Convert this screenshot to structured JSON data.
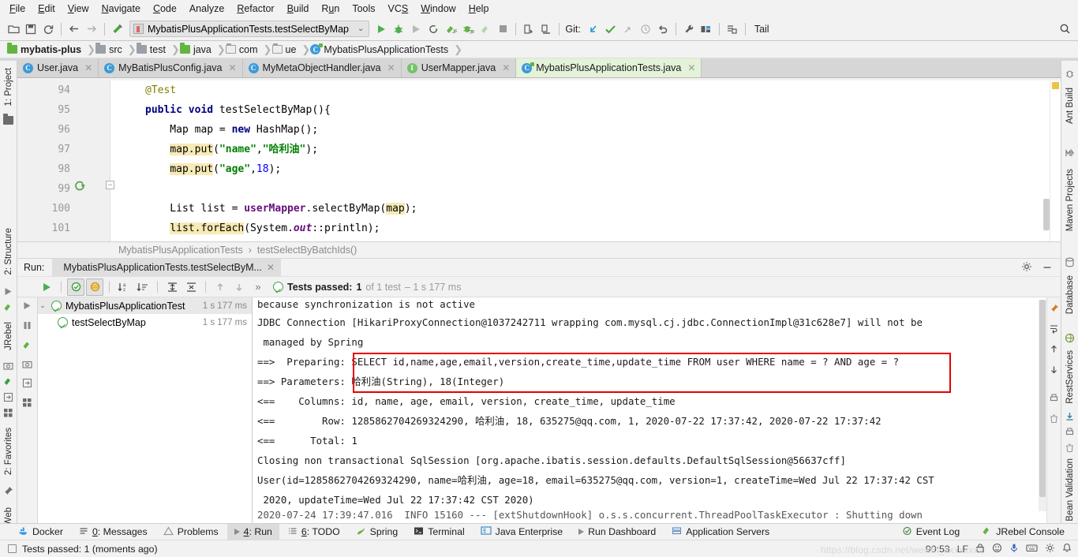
{
  "menu": {
    "items": [
      "File",
      "Edit",
      "View",
      "Navigate",
      "Code",
      "Analyze",
      "Refactor",
      "Build",
      "Run",
      "Tools",
      "VCS",
      "Window",
      "Help"
    ]
  },
  "toolbar": {
    "run_config": "MybatisPlusApplicationTests.testSelectByMap",
    "git_label": "Git:",
    "tail_label": "Tail",
    "icons": [
      "open-folder-icon",
      "save-icon",
      "sync-icon",
      "back-arrow-icon",
      "forward-arrow-icon",
      "build-hammer-icon",
      "run-icon",
      "debug-icon",
      "run-with-coverage-icon",
      "profiler-icon",
      "run-junit-icon",
      "debug-junit-icon",
      "stop-icon",
      "update-project-icon",
      "commit-icon",
      "vcs-pull-icon",
      "vcs-push-icon",
      "vcs-cherrypick-icon",
      "vcs-history-icon",
      "vcs-revert-icon",
      "settings-wrench-icon",
      "project-structure-icon",
      "database-icon",
      "search-icon"
    ]
  },
  "breadcrumb": {
    "items": [
      {
        "label": "mybatis-plus",
        "icon": "module-icon",
        "bold": true
      },
      {
        "label": "src",
        "icon": "folder-icon",
        "bold": false
      },
      {
        "label": "test",
        "icon": "folder-icon",
        "bold": false
      },
      {
        "label": "java",
        "icon": "source-folder-icon",
        "bold": false
      },
      {
        "label": "com",
        "icon": "package-icon",
        "bold": false
      },
      {
        "label": "ue",
        "icon": "package-icon",
        "bold": false
      },
      {
        "label": "MybatisPlusApplicationTests",
        "icon": "test-class-icon",
        "bold": false
      }
    ]
  },
  "tabs": [
    {
      "label": "User.java",
      "icon": "class-icon",
      "active": false
    },
    {
      "label": "MyBatisPlusConfig.java",
      "icon": "class-icon",
      "active": false
    },
    {
      "label": "MyMetaObjectHandler.java",
      "icon": "class-icon",
      "active": false
    },
    {
      "label": "UserMapper.java",
      "icon": "interface-icon",
      "active": false
    },
    {
      "label": "MybatisPlusApplicationTests.java",
      "icon": "test-class-icon",
      "active": true
    }
  ],
  "left_strip": {
    "project_label": "1: Project",
    "structure_label": "2: Structure",
    "jrebel_label": "JRebel",
    "favorites_label": "2: Favorites",
    "web_label": "Web"
  },
  "right_strip": {
    "ant_label": "Ant Build",
    "maven_label": "Maven Projects",
    "database_label": "Database",
    "rest_label": "RestServices",
    "bean_label": "Bean Validation"
  },
  "editor": {
    "lines": [
      {
        "num": "94",
        "code": "    @Test"
      },
      {
        "num": "95",
        "code": "    public void testSelectByMap(){"
      },
      {
        "num": "96",
        "code": "        Map map = new HashMap();"
      },
      {
        "num": "97",
        "code": "        map.put(\"name\",\"哈利油\");"
      },
      {
        "num": "98",
        "code": "        map.put(\"age\",18);"
      },
      {
        "num": "99",
        "code": ""
      },
      {
        "num": "100",
        "code": "        List list = userMapper.selectByMap(map);"
      },
      {
        "num": "101",
        "code": "        list.forEach(System.out::println);"
      }
    ]
  },
  "editor_breadcrumb": {
    "class_name": "MybatisPlusApplicationTests",
    "separator": "›",
    "method_name": "testSelectByBatchIds()"
  },
  "run_window": {
    "title": "Run:",
    "tab_label": "MybatisPlusApplicationTests.testSelectByM...",
    "toolbar_icons": [
      "rerun-icon",
      "toggle-passed-icon",
      "toggle-ignored-icon",
      "sort-alphabetically-icon",
      "sort-duration-icon",
      "expand-all-icon",
      "collapse-all-icon",
      "prev-failed-icon",
      "next-failed-icon",
      "more-icon"
    ],
    "status": {
      "prefix": "Tests passed:",
      "count": "1",
      "of": "of 1 test",
      "duration": "– 1 s 177 ms"
    },
    "tree": [
      {
        "label": "MybatisPlusApplicationTest",
        "time": "1 s 177 ms",
        "level": 0,
        "selected": true
      },
      {
        "label": "testSelectByMap",
        "time": "1 s 177 ms",
        "level": 1,
        "selected": false
      }
    ]
  },
  "console": {
    "lines": [
      "because synchronization is not active",
      "JDBC Connection [HikariProxyConnection@1037242711 wrapping com.mysql.cj.jdbc.ConnectionImpl@31c628e7] will not be",
      " managed by Spring",
      "==>  Preparing: SELECT id,name,age,email,version,create_time,update_time FROM user WHERE name = ? AND age = ?",
      "==> Parameters: 哈利油(String), 18(Integer)",
      "<==    Columns: id, name, age, email, version, create_time, update_time",
      "<==        Row: 1285862704269324290, 哈利油, 18, 635275@qq.com, 1, 2020-07-22 17:37:42, 2020-07-22 17:37:42",
      "<==      Total: 1",
      "Closing non transactional SqlSession [org.apache.ibatis.session.defaults.DefaultSqlSession@56637cff]",
      "User(id=1285862704269324290, name=哈利油, age=18, email=635275@qq.com, version=1, createTime=Wed Jul 22 17:37:42 CST",
      " 2020, updateTime=Wed Jul 22 17:37:42 CST 2020)",
      "2020-07-24 17:39:47.016  INFO 15160 --- [extShutdownHook] o.s.s.concurrent.ThreadPoolTaskExecutor : Shutting down"
    ],
    "highlight_color": "#e60000"
  },
  "bottom_bar": {
    "items": [
      {
        "label": "Docker",
        "icon": "docker-icon",
        "active": false,
        "mnemonic": ""
      },
      {
        "label": "0: Messages",
        "icon": "messages-icon",
        "active": false,
        "mnemonic": "0"
      },
      {
        "label": "Problems",
        "icon": "problems-icon",
        "active": false,
        "mnemonic": ""
      },
      {
        "label": "4: Run",
        "icon": "run-icon",
        "active": true,
        "mnemonic": "4"
      },
      {
        "label": "6: TODO",
        "icon": "todo-icon",
        "active": false,
        "mnemonic": "6"
      },
      {
        "label": "Spring",
        "icon": "spring-icon",
        "active": false,
        "mnemonic": ""
      },
      {
        "label": "Terminal",
        "icon": "terminal-icon",
        "active": false,
        "mnemonic": ""
      },
      {
        "label": "Java Enterprise",
        "icon": "java-enterprise-icon",
        "active": false,
        "mnemonic": ""
      },
      {
        "label": "Run Dashboard",
        "icon": "run-dashboard-icon",
        "active": false,
        "mnemonic": ""
      },
      {
        "label": "Application Servers",
        "icon": "app-servers-icon",
        "active": false,
        "mnemonic": ""
      }
    ],
    "right_items": [
      {
        "label": "Event Log",
        "icon": "event-log-icon"
      },
      {
        "label": "JRebel Console",
        "icon": "jrebel-icon"
      }
    ]
  },
  "status_bar": {
    "message": "Tests passed: 1 (moments ago)",
    "position": "90:53",
    "encoding": "LF",
    "watermark": "https://blog.csdn.net/weixin_xxxxxxxx"
  }
}
